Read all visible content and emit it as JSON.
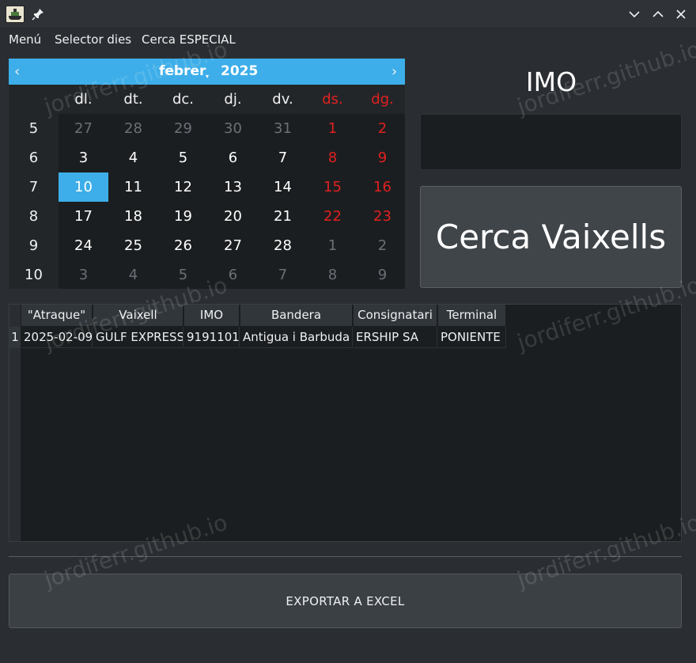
{
  "window": {
    "title_icons": [
      "ship-app-icon",
      "pin-icon"
    ],
    "controls": [
      "minimize-icon",
      "maximize-icon",
      "close-icon"
    ]
  },
  "menu": {
    "items": [
      "Menú",
      "Selector dies",
      "Cerca ESPECIAL"
    ]
  },
  "calendar": {
    "month": "febrer",
    "year": "2025",
    "days_of_week": [
      "dl.",
      "dt.",
      "dc.",
      "dj.",
      "dv.",
      "ds.",
      "dg."
    ],
    "weeks": [
      {
        "num": "5",
        "days": [
          "27",
          "28",
          "29",
          "30",
          "31",
          "1",
          "2"
        ]
      },
      {
        "num": "6",
        "days": [
          "3",
          "4",
          "5",
          "6",
          "7",
          "8",
          "9"
        ]
      },
      {
        "num": "7",
        "days": [
          "10",
          "11",
          "12",
          "13",
          "14",
          "15",
          "16"
        ]
      },
      {
        "num": "8",
        "days": [
          "17",
          "18",
          "19",
          "20",
          "21",
          "22",
          "23"
        ]
      },
      {
        "num": "9",
        "days": [
          "24",
          "25",
          "26",
          "27",
          "28",
          "1",
          "2"
        ]
      },
      {
        "num": "10",
        "days": [
          "3",
          "4",
          "5",
          "6",
          "7",
          "8",
          "9"
        ]
      }
    ],
    "selected_day": "10",
    "accent_color": "#3daee9",
    "weekend_color": "#e02020"
  },
  "imo": {
    "label": "IMO",
    "value": ""
  },
  "search_button": {
    "label": "Cerca Vaixells"
  },
  "table": {
    "columns": [
      "\"Atraque\"",
      "Vaixell",
      "IMO",
      "Bandera",
      "Consignatari",
      "Terminal"
    ],
    "rows": [
      {
        "num": "1",
        "cells": [
          "2025-02-09",
          "GULF EXPRESS",
          "9191101",
          "Antigua i Barbuda",
          "ERSHIP SA",
          "PONIENTE"
        ]
      }
    ]
  },
  "export_button": {
    "label": "EXPORTAR  A  EXCEL"
  },
  "watermark": {
    "text": "jordiferr.github.io"
  }
}
